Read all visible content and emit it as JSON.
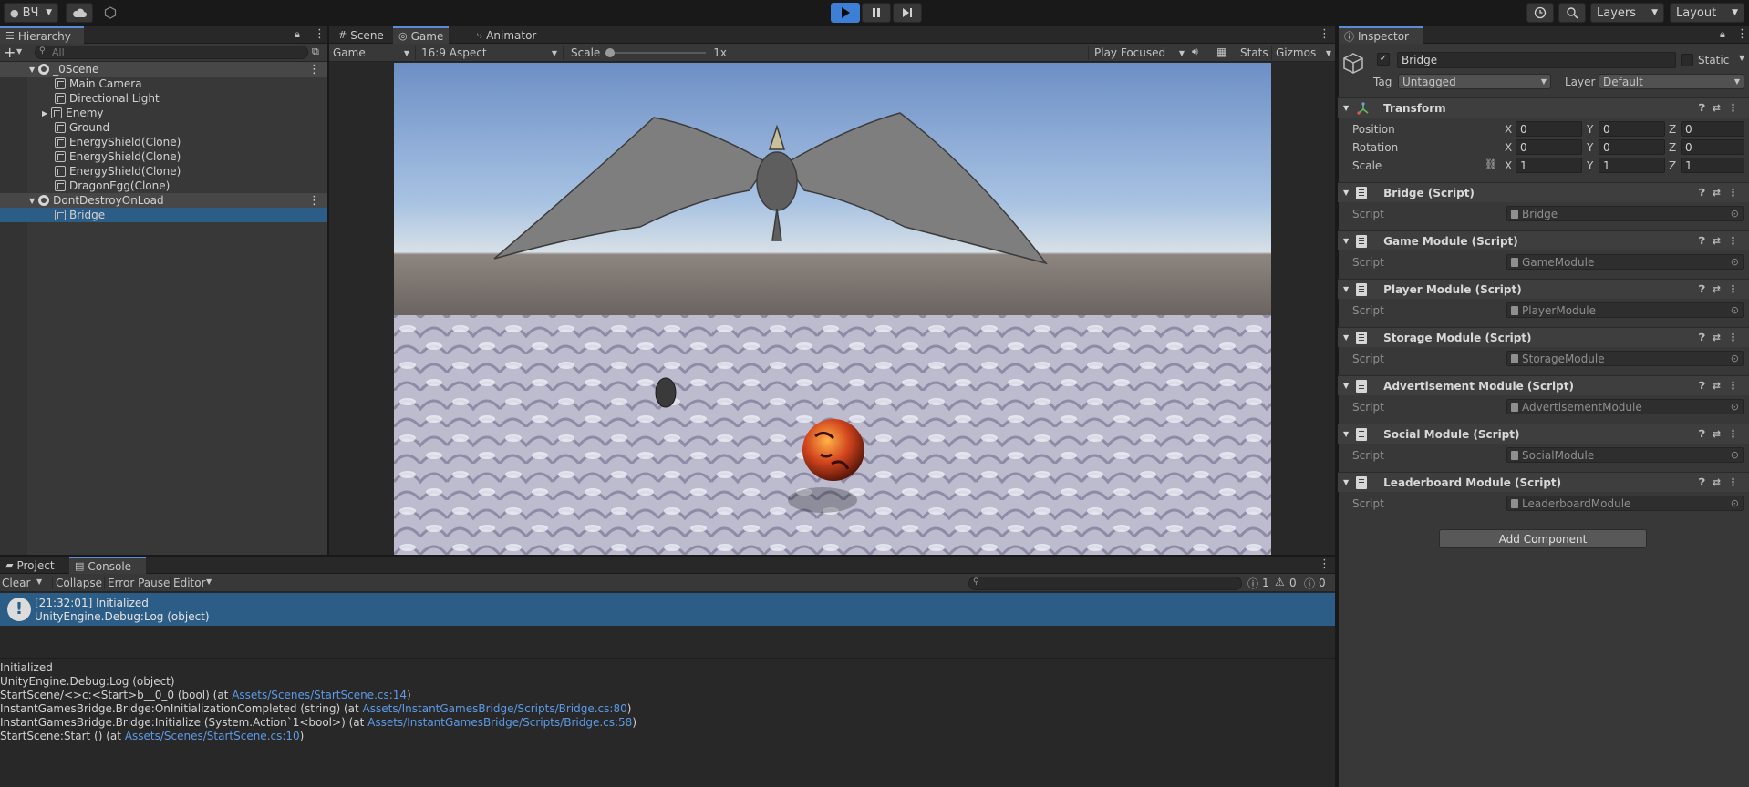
{
  "toolbar": {
    "account": "ВЧ",
    "layers": "Layers",
    "layout": "Layout"
  },
  "hierarchy": {
    "tab": "Hierarchy",
    "search_placeholder": "All",
    "items": [
      {
        "label": "_0Scene"
      },
      {
        "label": "Main Camera"
      },
      {
        "label": "Directional Light"
      },
      {
        "label": "Enemy"
      },
      {
        "label": "Ground"
      },
      {
        "label": "EnergyShield(Clone)"
      },
      {
        "label": "EnergyShield(Clone)"
      },
      {
        "label": "EnergyShield(Clone)"
      },
      {
        "label": "DragonEgg(Clone)"
      },
      {
        "label": "DontDestroyOnLoad"
      },
      {
        "label": "Bridge"
      }
    ]
  },
  "center": {
    "tabs": [
      "Scene",
      "Game",
      "Animator"
    ],
    "game_toolbar": {
      "display": "Game",
      "aspect": "16:9 Aspect",
      "scale_label": "Scale",
      "scale_value": "1x",
      "play_mode": "Play Focused",
      "stats": "Stats",
      "gizmos": "Gizmos"
    }
  },
  "inspector": {
    "tab": "Inspector",
    "object_name": "Bridge",
    "static_label": "Static",
    "tag_label": "Tag",
    "tag_value": "Untagged",
    "layer_label": "Layer",
    "layer_value": "Default",
    "transform": {
      "title": "Transform",
      "position_label": "Position",
      "rotation_label": "Rotation",
      "scale_label": "Scale",
      "x": "X",
      "y": "Y",
      "z": "Z",
      "position": [
        "0",
        "0",
        "0"
      ],
      "rotation": [
        "0",
        "0",
        "0"
      ],
      "scale": [
        "1",
        "1",
        "1"
      ]
    },
    "script_label": "Script",
    "components": [
      {
        "title": "Bridge (Script)",
        "script": "Bridge"
      },
      {
        "title": "Game Module (Script)",
        "script": "GameModule"
      },
      {
        "title": "Player Module (Script)",
        "script": "PlayerModule"
      },
      {
        "title": "Storage Module (Script)",
        "script": "StorageModule"
      },
      {
        "title": "Advertisement Module (Script)",
        "script": "AdvertisementModule"
      },
      {
        "title": "Social Module (Script)",
        "script": "SocialModule"
      },
      {
        "title": "Leaderboard Module (Script)",
        "script": "LeaderboardModule"
      }
    ],
    "add_component": "Add Component"
  },
  "console": {
    "tabs": [
      "Project",
      "Console"
    ],
    "toolbar": {
      "clear": "Clear",
      "collapse": "Collapse",
      "error_pause": "Error Pause",
      "editor": "Editor",
      "info_count": "1",
      "warn_count": "0",
      "error_count": "0"
    },
    "selected_entry": {
      "line1": "[21:32:01] Initialized",
      "line2": "UnityEngine.Debug:Log (object)"
    },
    "detail": {
      "l1": "Initialized",
      "l2": "UnityEngine.Debug:Log (object)",
      "l3_pre": "StartScene/<>c:<Start>b__0_0 (bool) (at ",
      "l3_link": "Assets/Scenes/StartScene.cs:14",
      "l3_post": ")",
      "l4_pre": "InstantGamesBridge.Bridge:OnInitializationCompleted (string) (at ",
      "l4_link": "Assets/InstantGamesBridge/Scripts/Bridge.cs:80",
      "l4_post": ")",
      "l5_pre": "InstantGamesBridge.Bridge:Initialize (System.Action`1<bool>) (at ",
      "l5_link": "Assets/InstantGamesBridge/Scripts/Bridge.cs:58",
      "l5_post": ")",
      "l6_pre": "StartScene:Start () (at ",
      "l6_link": "Assets/Scenes/StartScene.cs:10",
      "l6_post": ")"
    }
  },
  "colors": {
    "accent": "#2c5d87",
    "link": "#5c9ae6",
    "play": "#3d7ed6"
  }
}
